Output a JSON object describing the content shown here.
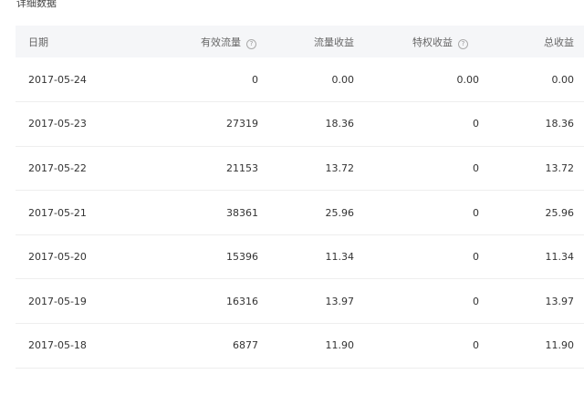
{
  "section_title": "详细数据",
  "icons": {
    "help": "question-circle-icon"
  },
  "table": {
    "headers": {
      "date": "日期",
      "valid_flow": "有效流量",
      "flow_income": "流量收益",
      "privilege_income": "特权收益",
      "total_income": "总收益"
    },
    "help_glyph": "?",
    "rows": [
      {
        "date": "2017-05-24",
        "valid_flow": "0",
        "flow_income": "0.00",
        "privilege_income": "0.00",
        "total_income": "0.00"
      },
      {
        "date": "2017-05-23",
        "valid_flow": "27319",
        "flow_income": "18.36",
        "privilege_income": "0",
        "total_income": "18.36"
      },
      {
        "date": "2017-05-22",
        "valid_flow": "21153",
        "flow_income": "13.72",
        "privilege_income": "0",
        "total_income": "13.72"
      },
      {
        "date": "2017-05-21",
        "valid_flow": "38361",
        "flow_income": "25.96",
        "privilege_income": "0",
        "total_income": "25.96"
      },
      {
        "date": "2017-05-20",
        "valid_flow": "15396",
        "flow_income": "11.34",
        "privilege_income": "0",
        "total_income": "11.34"
      },
      {
        "date": "2017-05-19",
        "valid_flow": "16316",
        "flow_income": "13.97",
        "privilege_income": "0",
        "total_income": "13.97"
      },
      {
        "date": "2017-05-18",
        "valid_flow": "6877",
        "flow_income": "11.90",
        "privilege_income": "0",
        "total_income": "11.90"
      }
    ]
  }
}
